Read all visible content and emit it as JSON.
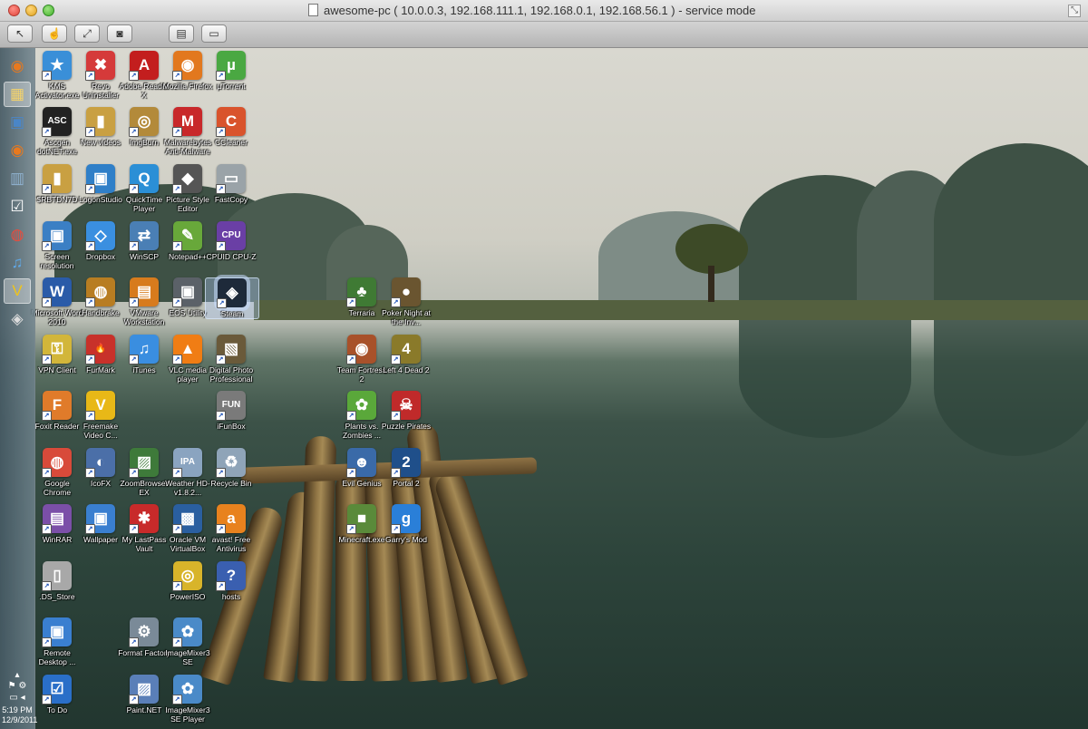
{
  "window": {
    "title": "awesome-pc ( 10.0.0.3, 192.168.111.1, 192.168.0.1, 192.168.56.1 ) - service mode"
  },
  "toolbar": {
    "buttons": [
      {
        "icon": "pointer-arrows-icon",
        "glyph": "↖",
        "active": true
      },
      {
        "icon": "share-hand-icon",
        "glyph": "☝",
        "active": false
      },
      {
        "icon": "fullscreen-icon",
        "glyph": "⤢",
        "active": true
      },
      {
        "icon": "screenshot-camera-icon",
        "glyph": "◙",
        "active": false
      },
      {
        "icon": "clipboard-icon",
        "glyph": "▤",
        "active": false
      },
      {
        "icon": "folder-transfer-icon",
        "glyph": "▭",
        "active": false
      }
    ]
  },
  "taskbar": {
    "items": [
      {
        "name": "firefox",
        "glyph": "◉",
        "color": "#e8791e"
      },
      {
        "name": "file-explorer",
        "glyph": "▦",
        "color": "#f4d36b"
      },
      {
        "name": "monitor",
        "glyph": "▣",
        "color": "#4a86c8"
      },
      {
        "name": "firefox-2",
        "glyph": "◉",
        "color": "#e8791e"
      },
      {
        "name": "network",
        "glyph": "▥",
        "color": "#8fb2d0"
      },
      {
        "name": "checkbox",
        "glyph": "☑",
        "color": "#ffffff"
      },
      {
        "name": "chrome",
        "glyph": "◍",
        "color": "#e84c3d"
      },
      {
        "name": "itunes",
        "glyph": "♫",
        "color": "#5fa8e8"
      },
      {
        "name": "freemake",
        "glyph": "V",
        "color": "#f0c419"
      },
      {
        "name": "steam",
        "glyph": "◈",
        "color": "#dddddd"
      }
    ],
    "time": "5:19 PM",
    "date": "12/9/2011"
  },
  "desktop_icons": [
    {
      "label": "KMS Activator.exe",
      "glyph": "★",
      "color": "#3a8fd8"
    },
    {
      "label": "Revo Uninstaller",
      "glyph": "✖",
      "color": "#d53a3a"
    },
    {
      "label": "Adobe Reader X",
      "glyph": "A",
      "color": "#c31e1e"
    },
    {
      "label": "Mozilla Firefox",
      "glyph": "◉",
      "color": "#e2781e"
    },
    {
      "label": "µTorrent",
      "glyph": "µ",
      "color": "#4aa842"
    },
    {
      "label": "Ascgen dotNET.exe",
      "glyph": "ASC",
      "color": "#222222"
    },
    {
      "label": "New videos",
      "glyph": "▮",
      "color": "#c9a042"
    },
    {
      "label": "ImgBurn",
      "glyph": "◎",
      "color": "#b38a3a"
    },
    {
      "label": "Malwarebytes Anti-Malware",
      "glyph": "M",
      "color": "#c8282a"
    },
    {
      "label": "CCleaner",
      "glyph": "C",
      "color": "#d9532c"
    },
    {
      "label": "$RBTDN7D",
      "glyph": "▮",
      "color": "#c9a042"
    },
    {
      "label": "LogonStudio",
      "glyph": "▣",
      "color": "#2f7fc8"
    },
    {
      "label": "QuickTime Player",
      "glyph": "Q",
      "color": "#2b8fd6"
    },
    {
      "label": "Picture Style Editor",
      "glyph": "◆",
      "color": "#555555"
    },
    {
      "label": "FastCopy",
      "glyph": "▭",
      "color": "#9aa3a8"
    },
    {
      "label": "Screen resolution",
      "glyph": "▣",
      "color": "#3b7fc4"
    },
    {
      "label": "Dropbox",
      "glyph": "◇",
      "color": "#3a8fe0"
    },
    {
      "label": "WinSCP",
      "glyph": "⇄",
      "color": "#4a7fb5"
    },
    {
      "label": "Notepad++",
      "glyph": "✎",
      "color": "#68a83a"
    },
    {
      "label": "CPUID CPU-Z",
      "glyph": "CPU",
      "color": "#6a3fa5"
    },
    {
      "label": "Microsoft Word 2010",
      "glyph": "W",
      "color": "#2a5ba8"
    },
    {
      "label": "Handbrake",
      "glyph": "◍",
      "color": "#b87d22"
    },
    {
      "label": "VMware Workstation",
      "glyph": "▤",
      "color": "#d77b1d"
    },
    {
      "label": "EOS Utility",
      "glyph": "▣",
      "color": "#5b6168"
    },
    {
      "label": "Steam",
      "glyph": "◈",
      "color": "#1e2a3a"
    },
    {
      "label": "VPN Client",
      "glyph": "⚿",
      "color": "#d2b63a"
    },
    {
      "label": "FurMark",
      "glyph": "🔥",
      "color": "#c8312a"
    },
    {
      "label": "iTunes",
      "glyph": "♫",
      "color": "#3a8ee0"
    },
    {
      "label": "VLC media player",
      "glyph": "▲",
      "color": "#f07d14"
    },
    {
      "label": "Digital Photo Professional",
      "glyph": "▧",
      "color": "#6a5a3a"
    },
    {
      "label": "Foxit Reader",
      "glyph": "F",
      "color": "#e07b2a"
    },
    {
      "label": "Freemake Video C...",
      "glyph": "V",
      "color": "#e8b817"
    },
    {
      "label": "iFunBox",
      "glyph": "FUN",
      "color": "#7a7a7a"
    },
    {
      "label": "Google Chrome",
      "glyph": "◍",
      "color": "#d84a3a"
    },
    {
      "label": "IcoFX",
      "glyph": "◐",
      "color": "#4b6fa8"
    },
    {
      "label": "ZoomBrowser EX",
      "glyph": "▨",
      "color": "#3e7a3a"
    },
    {
      "label": "Weather HD-v1.8.2...",
      "glyph": "IPA",
      "color": "#8aa4c0"
    },
    {
      "label": "Recycle Bin",
      "glyph": "♻",
      "color": "#8fa4b8"
    },
    {
      "label": "WinRAR",
      "glyph": "▤",
      "color": "#7b4fa8"
    },
    {
      "label": "Wallpaper",
      "glyph": "▣",
      "color": "#3a7fd0"
    },
    {
      "label": "My LastPass Vault",
      "glyph": "✱",
      "color": "#c82a2a"
    },
    {
      "label": "Oracle VM VirtualBox",
      "glyph": "▩",
      "color": "#2a5fa0"
    },
    {
      "label": "avast! Free Antivirus",
      "glyph": "a",
      "color": "#e8821e"
    },
    {
      "label": ".DS_Store",
      "glyph": "▯",
      "color": "#a8a8a8"
    },
    {
      "label": "PowerISO",
      "glyph": "◎",
      "color": "#d8b42a"
    },
    {
      "label": "hosts",
      "glyph": "?",
      "color": "#3a5fb0"
    },
    {
      "label": "Remote Desktop ...",
      "glyph": "▣",
      "color": "#3a7fd0"
    },
    {
      "label": "Format Factory",
      "glyph": "⚙",
      "color": "#7a8a98"
    },
    {
      "label": "ImageMixer3 SE",
      "glyph": "✿",
      "color": "#4a8ac8"
    },
    {
      "label": "To Do",
      "glyph": "☑",
      "color": "#2a6fc8"
    },
    {
      "label": "Paint.NET",
      "glyph": "▨",
      "color": "#5a7fb8"
    },
    {
      "label": "ImageMixer3 SE Player",
      "glyph": "✿",
      "color": "#4a8ac8"
    },
    {
      "label": "Terraria",
      "glyph": "♣",
      "color": "#3f7a34"
    },
    {
      "label": "Poker Night at the Inv...",
      "glyph": "●",
      "color": "#6a5530"
    },
    {
      "label": "Team Fortress 2",
      "glyph": "◉",
      "color": "#a8512a"
    },
    {
      "label": "Left 4 Dead 2",
      "glyph": "4",
      "color": "#8a7a2a"
    },
    {
      "label": "Plants vs. Zombies ...",
      "glyph": "✿",
      "color": "#5aa83a"
    },
    {
      "label": "Puzzle Pirates",
      "glyph": "☠",
      "color": "#c02a2a"
    },
    {
      "label": "Evil Genius",
      "glyph": "☻",
      "color": "#3a6aa8"
    },
    {
      "label": "Portal 2",
      "glyph": "2",
      "color": "#1f4f8a"
    },
    {
      "label": "Minecraft.exe",
      "glyph": "■",
      "color": "#5a8a3a"
    },
    {
      "label": "Garry's Mod",
      "glyph": "g",
      "color": "#2a7fd8"
    }
  ]
}
